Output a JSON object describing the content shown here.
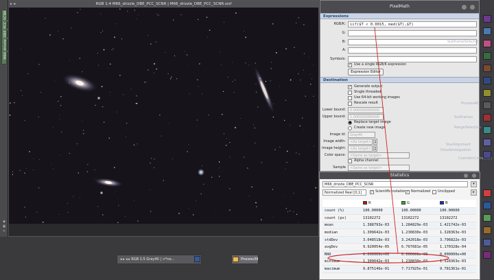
{
  "image_window": {
    "title": "RGB 1:4 M66_drizzle_DBE_PCC_SCNR | M66_drizzle_DBE_PCC_SCNR.xisf",
    "side_tab": "M66_drizzle_DBE_PCC_SCNR"
  },
  "mini_window": {
    "title": "RGB 1:5 Gray40 | <*ne..."
  },
  "process_icon": {
    "label": "Process39"
  },
  "pixelmath": {
    "title": "PixelMath",
    "expressions_header": "Expressions",
    "rgbk_label": "RGB/K:",
    "rgbk_value": "iif($T < 0.0015, med($T),$T)",
    "g_label": "G:",
    "b_label": "B:",
    "a_label": "A:",
    "symbols_label": "Symbols:",
    "use_single_label": "Use a single RGB/K expression",
    "expression_editor_label": "Expression Editor",
    "destination_header": "Destination",
    "generate_output_label": "Generate output",
    "single_threaded_label": "Single threaded",
    "use_64bit_label": "Use 64-bit working images",
    "rescale_label": "Rescale result",
    "lower_bound_label": "Lower bound:",
    "lower_bound_value": "0.000000000000",
    "upper_bound_label": "Upper bound:",
    "upper_bound_value": "1.000000000000",
    "replace_target_label": "Replace target image",
    "create_new_label": "Create new image",
    "image_id_label": "Image id:",
    "image_id_value": "Gray40",
    "image_width_label": "Image width:",
    "image_width_value": "<As target>",
    "image_height_label": "Image height:",
    "image_height_value": "<As target>",
    "color_space_label": "Color space:",
    "color_space_value": "<Same as target>",
    "alpha_channel_label": "Alpha channel",
    "sample_format_label": "Sample format:",
    "sample_format_value": "<Same as target>"
  },
  "statistics": {
    "title": "Statistics",
    "view_selector": "M66_drizzle_DBE_PCC_SCNR",
    "range_selector": "Normalized Real [0,1]",
    "scientific_label": "Scientific notation",
    "normalized_label": "Normalized",
    "unclipped_label": "Unclipped",
    "channels": [
      {
        "name": "R",
        "color": "#cc1111"
      },
      {
        "name": "G",
        "color": "#22bb22"
      },
      {
        "name": "B",
        "color": "#1133cc"
      }
    ],
    "rows": [
      {
        "label": "count (%)",
        "r": "100.00000",
        "g": "100.00000",
        "b": "100.00000"
      },
      {
        "label": "count (px)",
        "r": "13102272",
        "g": "13102272",
        "b": "13102272"
      },
      {
        "label": "mean",
        "r": "1.388793e-03",
        "g": "1.284829e-03",
        "b": "1.421742e-03"
      },
      {
        "label": "median",
        "r": "1.309642e-03",
        "g": "1.230830e-03",
        "b": "1.328363e-03"
      },
      {
        "label": "stdDev",
        "r": "3.048518e-03",
        "g": "3.242018e-03",
        "b": "3.796822e-03"
      },
      {
        "label": "avgDev",
        "r": "9.920054e-05",
        "g": "6.767681e-05",
        "b": "1.170328e-04"
      },
      {
        "label": "MAD",
        "r": "0.000000e+00",
        "g": "0.000000e+00",
        "b": "0.000000e+00"
      },
      {
        "label": "minimum",
        "r": "1.309642e-03",
        "g": "1.230830e-03",
        "b": "1.328363e-03"
      },
      {
        "label": "maximum",
        "r": "9.875146e-01",
        "g": "7.717925e-01",
        "b": "9.781361e-01"
      }
    ]
  },
  "background_icons": [
    "SubframeSelector",
    "Process40",
    "PixInsight",
    "Subframes",
    "RangeSelection",
    "StarAlignment",
    "DrizzleIntegration",
    "ImageIntegration",
    "CosmeticCorrection"
  ],
  "annotation_color": "#cc2222"
}
